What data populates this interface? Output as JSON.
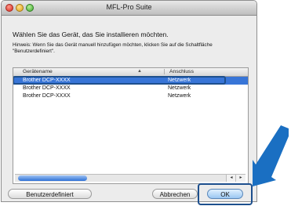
{
  "window": {
    "title": "MFL-Pro Suite"
  },
  "dialog": {
    "heading": "Wählen Sie das Gerät, das Sie installieren möchten.",
    "hint": "Hinweis: Wenn Sie das Gerät manuell hinzufügen möchten, klicken Sie auf die Schaltfläche \"Benutzerdefiniert\"."
  },
  "table": {
    "headers": {
      "name": "Gerätename",
      "connection": "Anschluss"
    },
    "sort_indicator": "▲",
    "rows": [
      {
        "name": "Brother DCP-XXXX",
        "connection": "Netzwerk",
        "selected": true
      },
      {
        "name": "Brother DCP-XXXX",
        "connection": "Netzwerk",
        "selected": false
      },
      {
        "name": "Brother DCP-XXXX",
        "connection": "Netzwerk",
        "selected": false
      }
    ],
    "scroll_left": "◂",
    "scroll_right": "▸"
  },
  "buttons": {
    "custom": "Benutzerdefiniert",
    "cancel": "Abbrechen",
    "ok": "OK"
  },
  "colors": {
    "accent": "#3875d7",
    "highlight": "#1d4f8d"
  },
  "icons": {
    "pointer": "arrow-pointer-icon"
  }
}
